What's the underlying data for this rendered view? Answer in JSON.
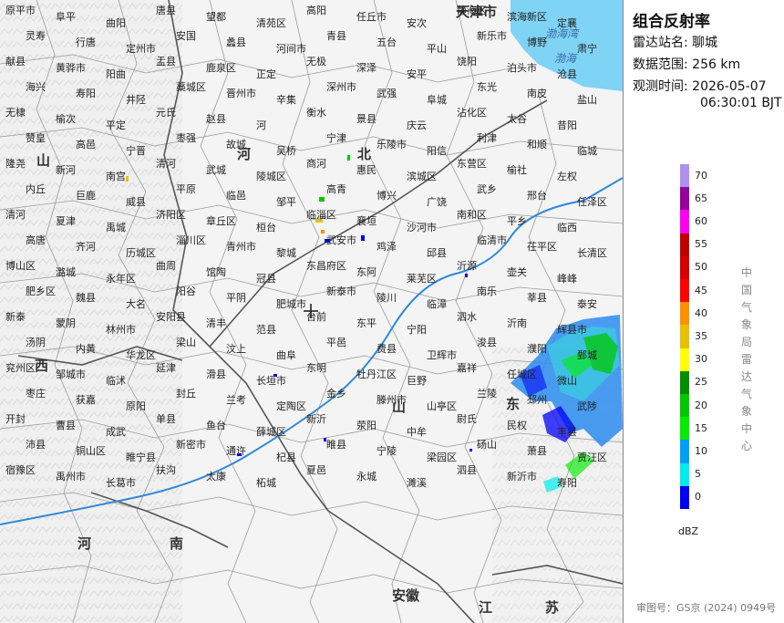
{
  "panel": {
    "title": "组合反射率",
    "station_label": "雷达站名:",
    "station": "聊城",
    "range_label": "数据范围:",
    "range": "256 km",
    "time_label": "观测时间:",
    "date": "2026-05-07",
    "time": "06:30:01 BJT",
    "unit": "dBZ",
    "vertical_text": [
      "中",
      "国",
      "气",
      "象",
      "局",
      "雷",
      "达",
      "气",
      "象",
      "中",
      "心"
    ],
    "approval": "审图号：GS京 (2024) 0949号"
  },
  "legend": [
    {
      "value": "70",
      "color": "#ad90f0"
    },
    {
      "value": "65",
      "color": "#96009b"
    },
    {
      "value": "60",
      "color": "#ff00f0"
    },
    {
      "value": "55",
      "color": "#c10000"
    },
    {
      "value": "50",
      "color": "#d60000"
    },
    {
      "value": "45",
      "color": "#ff0000"
    },
    {
      "value": "40",
      "color": "#ff9000"
    },
    {
      "value": "35",
      "color": "#e7c000"
    },
    {
      "value": "30",
      "color": "#ffff00"
    },
    {
      "value": "25",
      "color": "#008e00"
    },
    {
      "value": "20",
      "color": "#00c800"
    },
    {
      "value": "15",
      "color": "#00ec00"
    },
    {
      "value": "10",
      "color": "#01a0f6"
    },
    {
      "value": "5",
      "color": "#00ecec"
    },
    {
      "value": "0",
      "color": "#0000f6"
    }
  ],
  "provinces": [
    "天津市",
    "河",
    "北",
    "山",
    "西",
    "山",
    "东",
    "河",
    "南",
    "安徽",
    "江",
    "苏"
  ],
  "seas": [
    "渤海湾",
    "渤海"
  ],
  "cities": [
    "原平市",
    "阜平",
    "曲阳",
    "唐县",
    "望都",
    "清苑区",
    "高阳",
    "任丘市",
    "安次",
    "静海区",
    "滨海新区",
    "定襄",
    "灵寿",
    "行唐",
    "定州市",
    "安国",
    "蠡县",
    "河间市",
    "青县",
    "五台",
    "平山",
    "新乐市",
    "博野",
    "肃宁",
    "献县",
    "黄骅市",
    "阳曲",
    "盂县",
    "鹿泉区",
    "正定",
    "无极",
    "深泽",
    "安平",
    "饶阳",
    "泊头市",
    "沧县",
    "海兴",
    "寿阳",
    "井陉",
    "藁城区",
    "晋州市",
    "辛集",
    "深州市",
    "武强",
    "阜城",
    "东光",
    "南皮",
    "盐山",
    "无棣",
    "榆次",
    "平定",
    "元氏",
    "赵县",
    "河",
    "衡水",
    "景县",
    "庆云",
    "沾化区",
    "太谷",
    "昔阳",
    "赞皇",
    "高邑",
    "宁晋",
    "枣强",
    "故城",
    "吴桥",
    "宁津",
    "乐陵市",
    "阳信",
    "利津",
    "和顺",
    "临城",
    "隆尧",
    "新河",
    "南宫",
    "清河",
    "武城",
    "陵城区",
    "商河",
    "惠民",
    "滨城区",
    "东营区",
    "榆社",
    "左权",
    "内丘",
    "巨鹿",
    "威县",
    "平原",
    "临邑",
    "邹平",
    "高青",
    "博兴",
    "广饶",
    "武乡",
    "邢台",
    "任泽区",
    "清河",
    "夏津",
    "禹城",
    "济阳区",
    "章丘区",
    "桓台",
    "临淄区",
    "襄垣",
    "沙河市",
    "南和区",
    "平乡",
    "临西",
    "高唐",
    "齐河",
    "历城区",
    "淄川区",
    "青州市",
    "黎城",
    "武安市",
    "鸡泽",
    "邱县",
    "临清市",
    "茌平区",
    "长清区",
    "博山区",
    "潞城",
    "永年区",
    "曲周",
    "馆陶",
    "冠县",
    "东昌府区",
    "东阿",
    "莱芜区",
    "沂源",
    "壶关",
    "峰峰",
    "肥乡区",
    "魏县",
    "大名",
    "阳谷",
    "平阴",
    "肥城市",
    "新泰市",
    "陵川",
    "临漳",
    "南乐",
    "莘县",
    "泰安",
    "新泰",
    "蒙阴",
    "林州市",
    "安阳县",
    "清丰",
    "范县",
    "台前",
    "东平",
    "宁阳",
    "泗水",
    "沂南",
    "辉县市",
    "汤阴",
    "内黄",
    "华龙区",
    "梁山",
    "汶上",
    "曲阜",
    "平邑",
    "费县",
    "卫辉市",
    "浚县",
    "濮阳",
    "鄄城",
    "兖州区",
    "邹城市",
    "临沭",
    "延津",
    "滑县",
    "长垣市",
    "东明",
    "牡丹江区",
    "巨野",
    "嘉祥",
    "任城区",
    "微山",
    "枣庄",
    "获嘉",
    "原阳",
    "封丘",
    "兰考",
    "定陶区",
    "金乡",
    "滕州市",
    "山亭区",
    "兰陵",
    "邳州",
    "武陟",
    "开封",
    "曹县",
    "成武",
    "单县",
    "鱼台",
    "薛城区",
    "新沂",
    "荥阳",
    "中牟",
    "尉氏",
    "民权",
    "丰县",
    "沛县",
    "铜山区",
    "睢宁县",
    "新密市",
    "通许",
    "杞县",
    "睢县",
    "宁陵",
    "梁园区",
    "砀山",
    "萧县",
    "贾汪区",
    "宿豫区",
    "禹州市",
    "长葛市",
    "扶沟",
    "太康",
    "柘城",
    "夏邑",
    "永城",
    "濉溪",
    "泗县",
    "新沂市",
    "寿阳"
  ]
}
